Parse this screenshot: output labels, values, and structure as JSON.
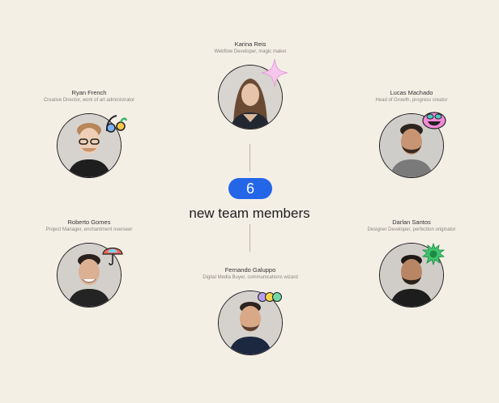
{
  "center": {
    "count": "6",
    "headline": "new team members"
  },
  "members": [
    {
      "name": "Karina Reis",
      "role": "Webflow Developer, magic maker"
    },
    {
      "name": "Ryan French",
      "role": "Creative Director, work of art administrator"
    },
    {
      "name": "Lucas Machado",
      "role": "Head of Growth, progress creator"
    },
    {
      "name": "Roberto Gomes",
      "role": "Project Manager, enchantment overseer"
    },
    {
      "name": "Darlan Santos",
      "role": "Designer Developer, perfection originator"
    },
    {
      "name": "Fernando Galuppo",
      "role": "Digital Media Buyer, communications wizard"
    }
  ],
  "colors": {
    "background": "#f4efe5",
    "accent": "#2466e8"
  }
}
